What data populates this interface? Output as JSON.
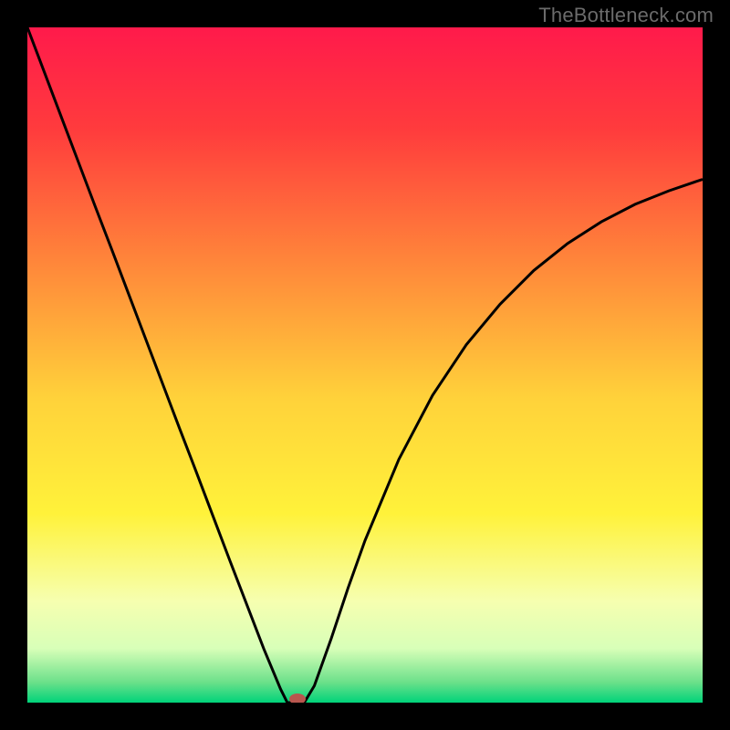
{
  "watermark": "TheBottleneck.com",
  "chart_data": {
    "type": "line",
    "title": "",
    "xlabel": "",
    "ylabel": "",
    "xlim": [
      0,
      100
    ],
    "ylim": [
      0,
      100
    ],
    "gradient_stops": [
      {
        "offset": 0.0,
        "color": "#ff1a4b"
      },
      {
        "offset": 0.15,
        "color": "#ff3b3d"
      },
      {
        "offset": 0.35,
        "color": "#ff873a"
      },
      {
        "offset": 0.55,
        "color": "#ffd23a"
      },
      {
        "offset": 0.72,
        "color": "#fff23a"
      },
      {
        "offset": 0.85,
        "color": "#f6ffb0"
      },
      {
        "offset": 0.92,
        "color": "#d8ffb8"
      },
      {
        "offset": 0.97,
        "color": "#6be08a"
      },
      {
        "offset": 1.0,
        "color": "#00d37a"
      }
    ],
    "series": [
      {
        "name": "bottleneck-curve",
        "x": [
          0.0,
          2.5,
          5.0,
          7.5,
          10.0,
          12.5,
          15.0,
          17.5,
          20.0,
          22.5,
          25.0,
          27.5,
          30.0,
          32.5,
          35.0,
          37.5,
          38.5,
          40.0,
          41.0,
          42.5,
          45.0,
          47.5,
          50.0,
          55.0,
          60.0,
          65.0,
          70.0,
          75.0,
          80.0,
          85.0,
          90.0,
          95.0,
          100.0
        ],
        "y": [
          100.0,
          93.4,
          86.8,
          80.2,
          73.6,
          67.1,
          60.5,
          53.9,
          47.3,
          40.7,
          34.2,
          27.6,
          21.0,
          14.5,
          8.0,
          2.0,
          0.0,
          0.0,
          0.0,
          2.5,
          9.5,
          17.0,
          24.0,
          36.0,
          45.5,
          53.0,
          59.0,
          64.0,
          68.0,
          71.2,
          73.8,
          75.8,
          77.5
        ]
      }
    ],
    "marker": {
      "x": 40.0,
      "y": 0.0,
      "color": "#b8564e"
    }
  }
}
